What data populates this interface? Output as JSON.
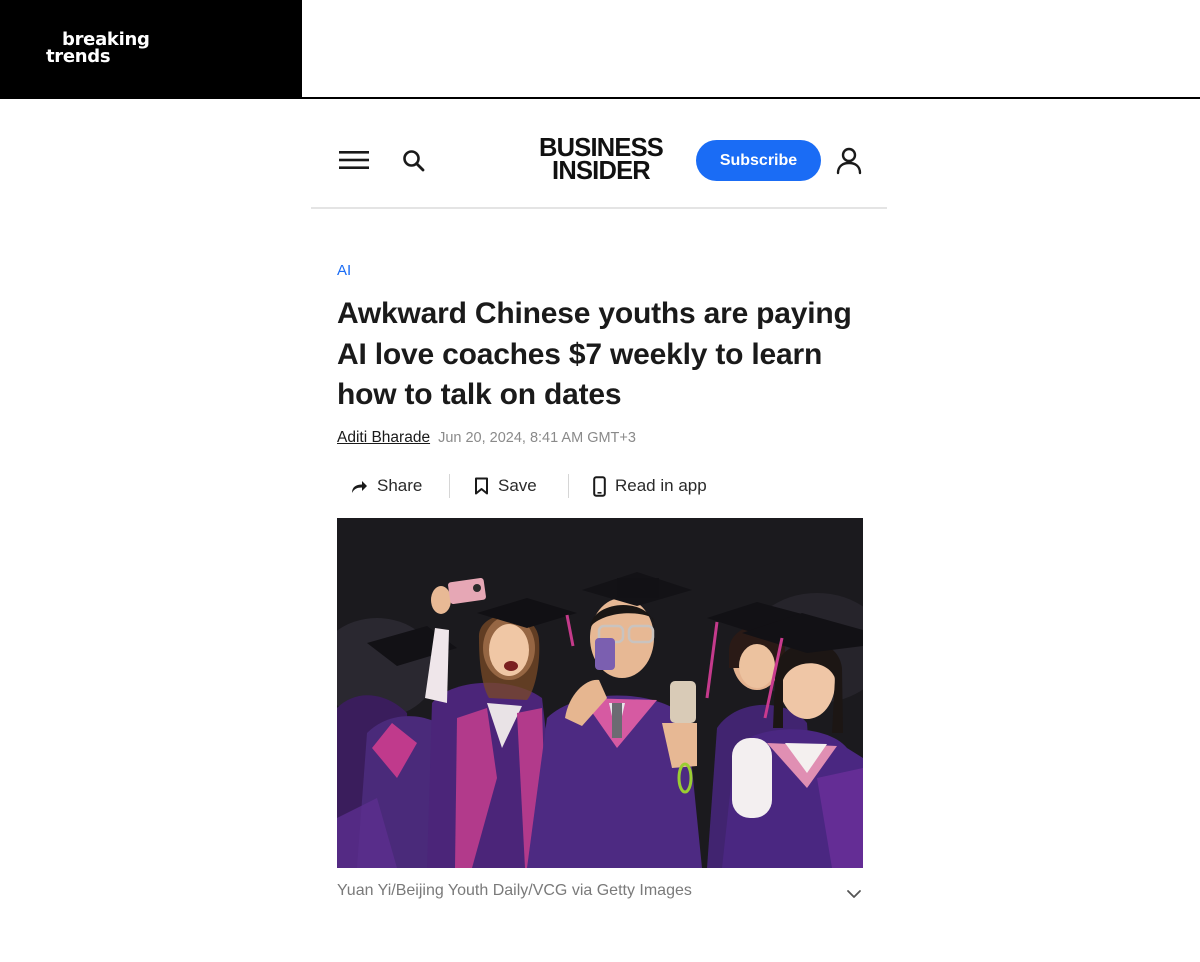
{
  "topbar": {
    "brand_line1": "breaking",
    "brand_line2": "trends"
  },
  "header": {
    "logo_line1": "BUSINESS",
    "logo_line2": "INSIDER",
    "subscribe_label": "Subscribe",
    "icons": {
      "menu": "hamburger-menu-icon",
      "search": "search-icon",
      "account": "person-icon"
    },
    "accent_color": "#1a6cf5"
  },
  "article": {
    "category": "AI",
    "headline": "Awkward Chinese youths are paying AI love coaches $7 weekly to learn how to talk on dates",
    "author": "Aditi Bharade",
    "timestamp": "Jun 20, 2024, 8:41 AM GMT+3",
    "actions": {
      "share": "Share",
      "save": "Save",
      "read_in_app": "Read in app"
    },
    "image_caption": "Yuan Yi/Beijing Youth Daily/VCG via Getty Images"
  }
}
